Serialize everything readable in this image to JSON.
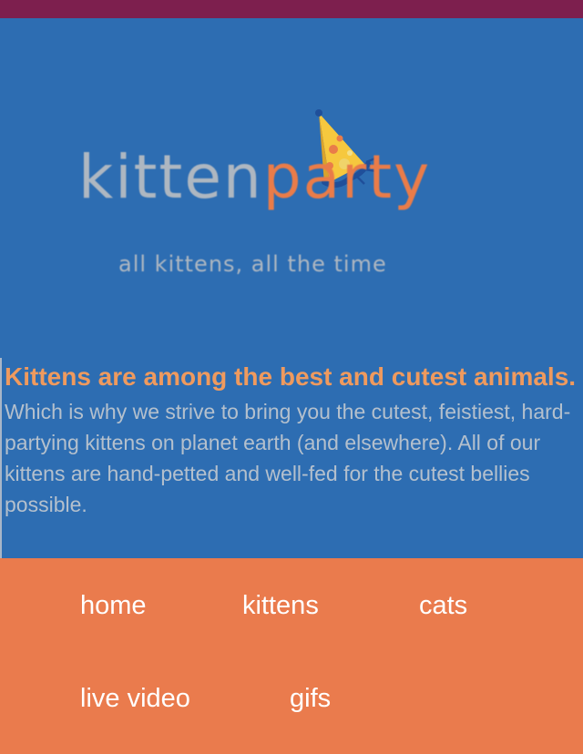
{
  "logo": {
    "word_left": "kitten",
    "word_right": "party",
    "tagline": "all kittens, all the time",
    "icon": "party-hat-icon",
    "colors": {
      "grey": "#aeb7c1",
      "orange": "#e97c49"
    }
  },
  "content": {
    "heading": "Kittens are among the best and cutest animals.",
    "body": "Which is why we strive to bring you the cutest, feistiest, hard-partying kittens on planet earth (and elsewhere). All of our kittens are hand-petted and well-fed for the cutest bellies possible."
  },
  "nav": {
    "items": [
      {
        "label": "home"
      },
      {
        "label": "kittens"
      },
      {
        "label": "cats"
      },
      {
        "label": "live video"
      },
      {
        "label": "gifs"
      }
    ]
  },
  "colors": {
    "top_bar": "#7d1f4e",
    "background": "#2d6db2",
    "heading": "#ef9a5e",
    "body_text": "#b4c0cd",
    "nav_bg": "#ea7b4d",
    "nav_text": "#ffffff"
  }
}
